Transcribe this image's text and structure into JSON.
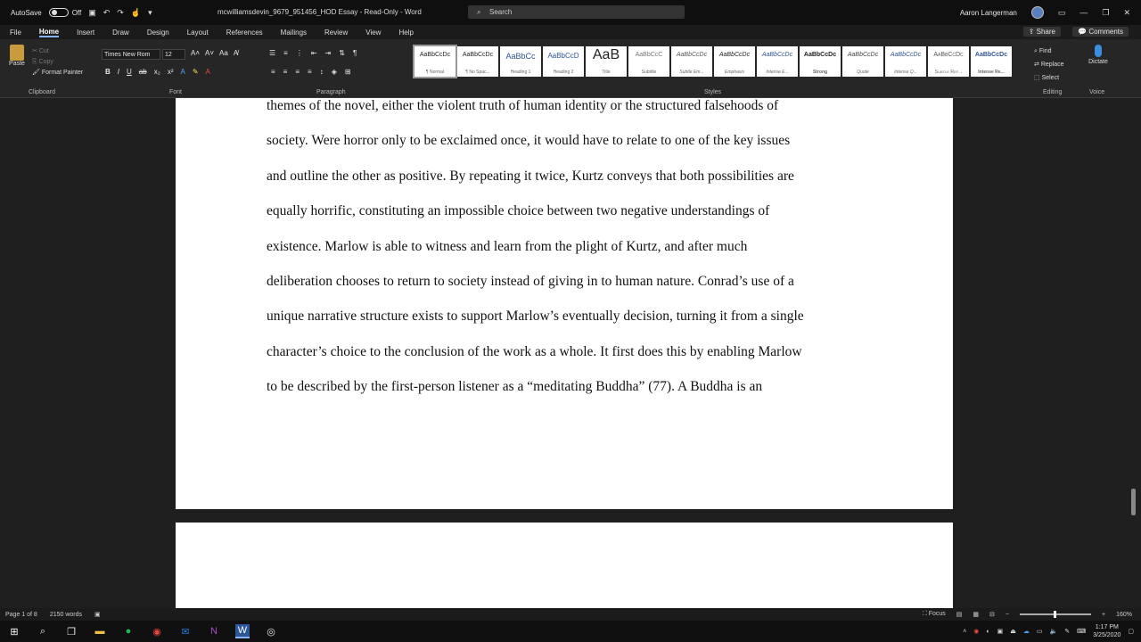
{
  "window": {
    "autosave_label": "AutoSave",
    "autosave_state": "Off",
    "title": "mcwilliamsdevin_9679_951456_HOD Essay  -  Read-Only  -  Word",
    "search_placeholder": "Search",
    "user_name": "Aaron Langerman"
  },
  "menu": {
    "tabs": [
      "File",
      "Home",
      "Insert",
      "Draw",
      "Design",
      "Layout",
      "References",
      "Mailings",
      "Review",
      "View",
      "Help"
    ],
    "share": "Share",
    "comments": "Comments"
  },
  "ribbon": {
    "paste": "Paste",
    "cut": "Cut",
    "copy": "Copy",
    "format_painter": "Format Painter",
    "font_name": "Times New Rom",
    "font_size": "12",
    "groups": {
      "clipboard": "Clipboard",
      "font": "Font",
      "paragraph": "Paragraph",
      "styles": "Styles",
      "editing": "Editing",
      "voice": "Voice"
    },
    "styles": [
      {
        "preview": "AaBbCcDc",
        "name": "¶ Normal"
      },
      {
        "preview": "AaBbCcDc",
        "name": "¶ No Spac..."
      },
      {
        "preview": "AaBbCc",
        "name": "Heading 1"
      },
      {
        "preview": "AaBbCcD",
        "name": "Heading 2"
      },
      {
        "preview": "AaB",
        "name": "Title"
      },
      {
        "preview": "AaBbCcC",
        "name": "Subtitle"
      },
      {
        "preview": "AaBbCcDc",
        "name": "Subtle Em..."
      },
      {
        "preview": "AaBbCcDc",
        "name": "Emphasis"
      },
      {
        "preview": "AaBbCcDc",
        "name": "Intense E..."
      },
      {
        "preview": "AaBbCcDc",
        "name": "Strong"
      },
      {
        "preview": "AaBbCcDc",
        "name": "Quote"
      },
      {
        "preview": "AaBbCcDc",
        "name": "Intense Q..."
      },
      {
        "preview": "AaBbCcDc",
        "name": "Subtle Ref..."
      },
      {
        "preview": "AaBbCcDc",
        "name": "Intense Re..."
      }
    ],
    "find": "Find",
    "replace": "Replace",
    "select": "Select",
    "dictate": "Dictate"
  },
  "document": {
    "lines": [
      "themes of the novel, either the violent truth of human identity or the structured falsehoods of",
      "society. Were horror only to be exclaimed once, it would have to relate to one of the key issues",
      "and outline the other as positive. By repeating it twice, Kurtz conveys that both possibilities are",
      "equally horrific, constituting an impossible choice between two negative understandings of",
      "existence. Marlow is able to witness and learn from the plight of Kurtz, and after much",
      "deliberation chooses to return to society instead of giving in to human nature. Conrad’s use of a",
      "unique narrative structure exists to support Marlow’s eventually decision, turning it from a single",
      "character’s choice to the conclusion of the work as a whole. It first does this by enabling Marlow",
      "to be described by the first-person listener as a “meditating Buddha” (77). A Buddha is an"
    ]
  },
  "status": {
    "page": "Page 1 of 8",
    "words": "2150 words",
    "focus": "Focus",
    "zoom": "160%"
  },
  "taskbar": {
    "time": "1:17 PM",
    "date": "3/25/2020"
  }
}
